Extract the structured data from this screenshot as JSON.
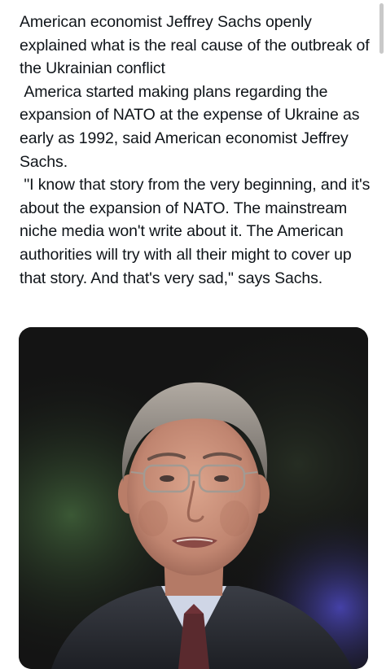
{
  "post": {
    "paragraphs": [
      "American economist Jeffrey Sachs openly explained what is the real cause of the outbreak of the Ukrainian conflict",
      " America started making plans regarding the expansion of NATO at the expense of Ukraine as early as 1992, said American economist Jeffrey Sachs.",
      " \"I know that story from the very beginning, and it's about the expansion of NATO. The mainstream niche media won't write about it. The American authorities will try with all their might to cover up that story. And that's very sad,\" says Sachs."
    ]
  },
  "media": {
    "type": "photo",
    "subject": "portrait",
    "palette": {
      "background": "#141414",
      "green_glow": "#2f4a2c",
      "blue_glow": "#3a3a9a",
      "skin": "#c9917a",
      "hair": "#8c8680",
      "suit": "#2b2d33",
      "shirt": "#cfd6e6",
      "tie": "#5a2a2e"
    }
  },
  "scrollbar": {
    "color": "#c9c9c9"
  }
}
